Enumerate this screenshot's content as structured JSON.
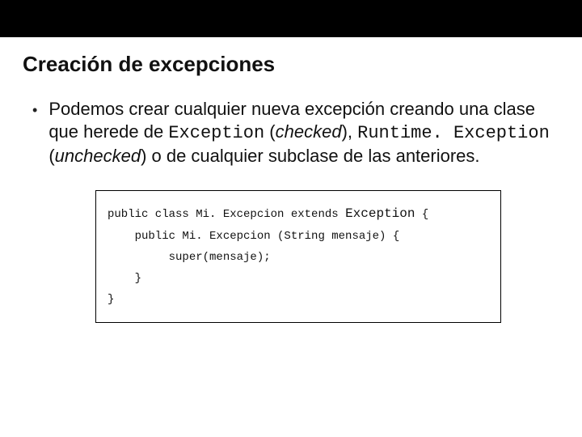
{
  "title": "Creación de excepciones",
  "para": {
    "p1a": "Podemos crear cualquier nueva excepción creando una clase que herede de ",
    "p1_code1": "Exception",
    "p1b": " (",
    "p1_ital1": "checked",
    "p1c": "), ",
    "p1_code2": "Runtime. Exception",
    "p1d": " (",
    "p1_ital2": "unchecked",
    "p1e": ") o de cualquier subclase de las anteriores."
  },
  "code": {
    "l1a": "public class Mi. Excepcion extends ",
    "l1b": "Exception",
    "l1c": " {",
    "l2": "    public Mi. Excepcion (String mensaje) {",
    "l3": "         super(mensaje);",
    "l4": "    }",
    "l5": "}"
  },
  "bullet_glyph": "•"
}
